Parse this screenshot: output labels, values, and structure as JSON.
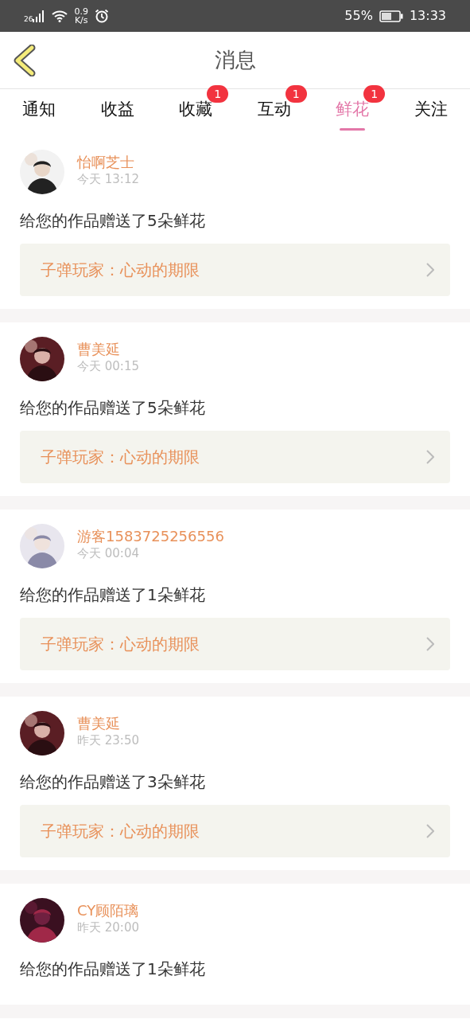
{
  "status_bar": {
    "network": "26",
    "speed": "0.9",
    "speed_unit": "K/s",
    "battery": "55%",
    "time": "13:33"
  },
  "header": {
    "title": "消息"
  },
  "tabs": [
    {
      "label": "通知",
      "selected": false
    },
    {
      "label": "收益",
      "selected": false
    },
    {
      "label": "收藏",
      "selected": false,
      "badge": "1"
    },
    {
      "label": "互动",
      "selected": false,
      "badge": "1"
    },
    {
      "label": "鲜花",
      "selected": true,
      "badge": "1"
    },
    {
      "label": "关注",
      "selected": false
    }
  ],
  "messages": [
    {
      "user": "怡啊芝士",
      "time": "今天 13:12",
      "text": "给您的作品赠送了5朵鲜花",
      "book": "子弹玩家：心动的期限"
    },
    {
      "user": "曹美延",
      "time": "今天 00:15",
      "text": "给您的作品赠送了5朵鲜花",
      "book": "子弹玩家：心动的期限"
    },
    {
      "user": "游客1583725256556",
      "time": "今天 00:04",
      "text": "给您的作品赠送了1朵鲜花",
      "book": "子弹玩家：心动的期限"
    },
    {
      "user": "曹美延",
      "time": "昨天 23:50",
      "text": "给您的作品赠送了3朵鲜花",
      "book": "子弹玩家：心动的期限"
    },
    {
      "user": "CY顾陌璃",
      "time": "昨天 20:00",
      "text": "给您的作品赠送了1朵鲜花"
    }
  ]
}
